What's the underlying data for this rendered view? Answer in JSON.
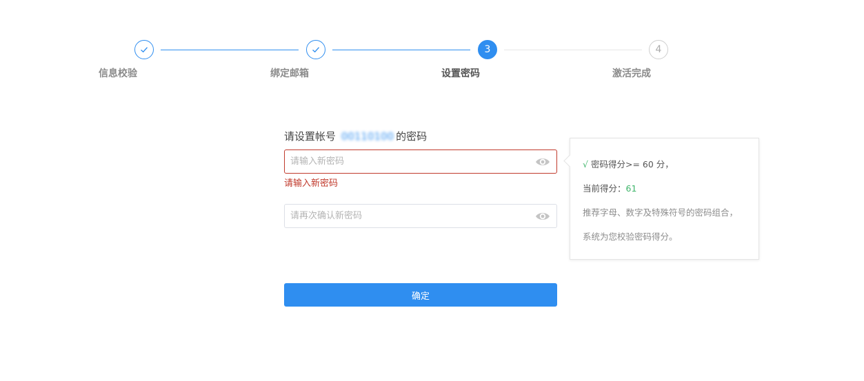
{
  "stepper": {
    "steps": [
      {
        "label": "信息校验",
        "state": "done",
        "number": "1"
      },
      {
        "label": "绑定邮箱",
        "state": "done",
        "number": "2"
      },
      {
        "label": "设置密码",
        "state": "active",
        "number": "3"
      },
      {
        "label": "激活完成",
        "state": "pending",
        "number": "4"
      }
    ]
  },
  "form": {
    "title_prefix": "请设置帐号",
    "account": "00110100",
    "title_suffix": "的密码",
    "new_password": {
      "value": "",
      "placeholder": "请输入新密码"
    },
    "new_password_error": "请输入新密码",
    "confirm_password": {
      "value": "",
      "placeholder": "请再次确认新密码"
    },
    "submit_label": "确定"
  },
  "tip": {
    "check_mark": "√",
    "rule": "密码得分>= 60 分，",
    "current_score_label": "当前得分：",
    "current_score": "61",
    "hint1": "推荐字母、数字及特殊符号的密码组合，",
    "hint2": "系统为您校验密码得分。"
  },
  "colors": {
    "primary": "#2f8ef0",
    "error": "#c0392b",
    "success": "#3eb56a"
  }
}
